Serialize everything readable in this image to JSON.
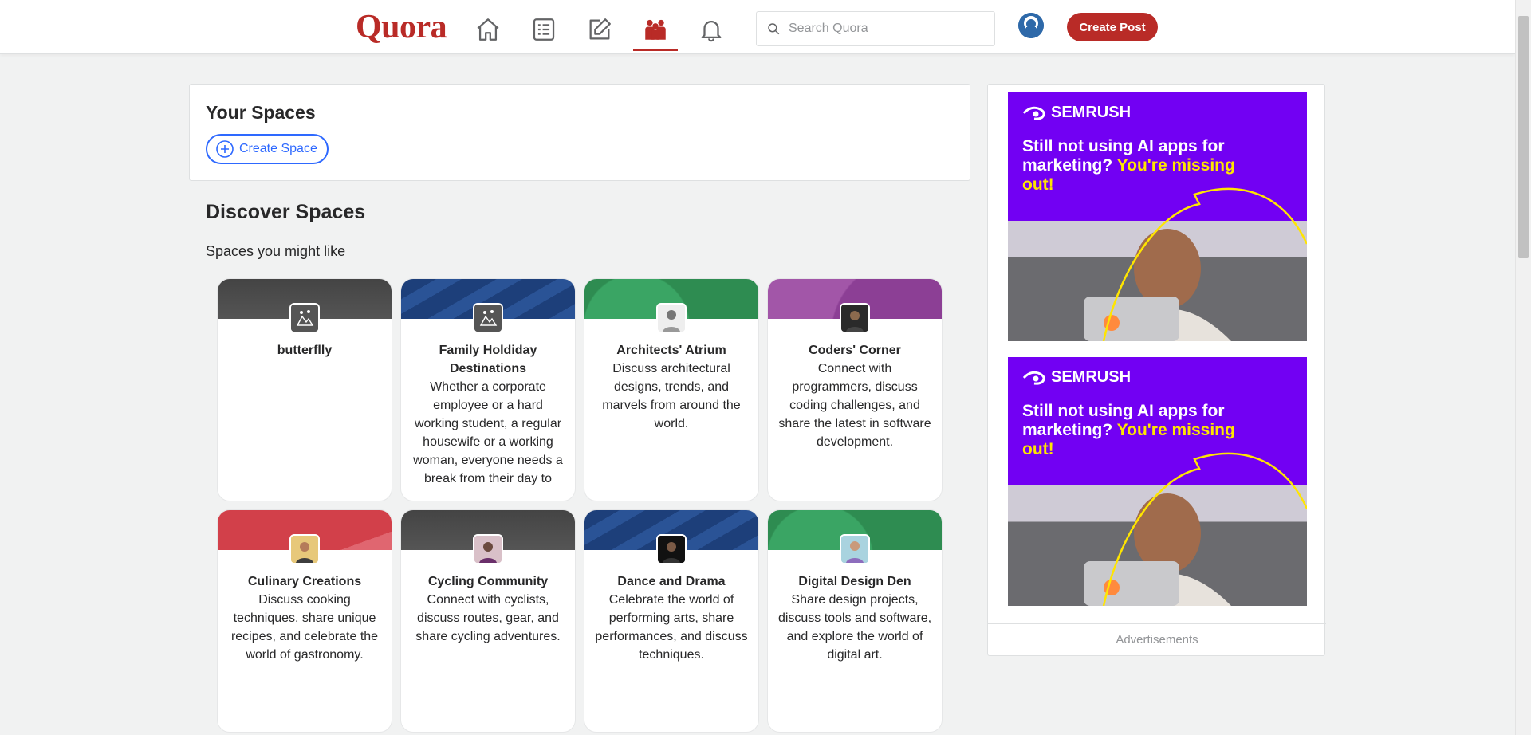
{
  "nav": {
    "logo": "Quora",
    "search_placeholder": "Search Quora",
    "create_post_label": "Create Post",
    "icons": [
      "home-icon",
      "following-icon",
      "answer-icon",
      "spaces-icon",
      "notifications-icon"
    ],
    "active_icon": "spaces-icon",
    "accent_color": "#b92b27"
  },
  "your_spaces": {
    "title": "Your Spaces",
    "create_space_label": "Create Space"
  },
  "discover": {
    "title": "Discover Spaces",
    "subtitle": "Spaces you might like",
    "spaces": [
      {
        "name": "butterflly",
        "description": ""
      },
      {
        "name": "Family Holdiday Destinations",
        "description": "Whether a corporate employee or a hard working student, a regular housewife or a working woman, everyone needs a break from their day to"
      },
      {
        "name": "Architects' Atrium",
        "description": "Discuss architectural designs, trends, and marvels from around the world."
      },
      {
        "name": "Coders' Corner",
        "description": "Connect with programmers, discuss coding challenges, and share the latest in software development."
      },
      {
        "name": "Culinary Creations",
        "description": "Discuss cooking techniques, share unique recipes, and celebrate the world of gastronomy."
      },
      {
        "name": "Cycling Community",
        "description": "Connect with cyclists, discuss routes, gear, and share cycling adventures."
      },
      {
        "name": "Dance and Drama",
        "description": "Celebrate the world of performing arts, share performances, and discuss techniques."
      },
      {
        "name": "Digital Design Den",
        "description": "Share design projects, discuss tools and software, and explore the world of digital art."
      }
    ]
  },
  "ads": {
    "items": [
      {
        "brand": "SEMRUSH",
        "headline": "Still not using AI apps for marketing?",
        "highlight": "You're missing out!"
      },
      {
        "brand": "SEMRUSH",
        "headline": "Still not using AI apps for marketing?",
        "highlight": "You're missing out!"
      }
    ],
    "label": "Advertisements"
  }
}
